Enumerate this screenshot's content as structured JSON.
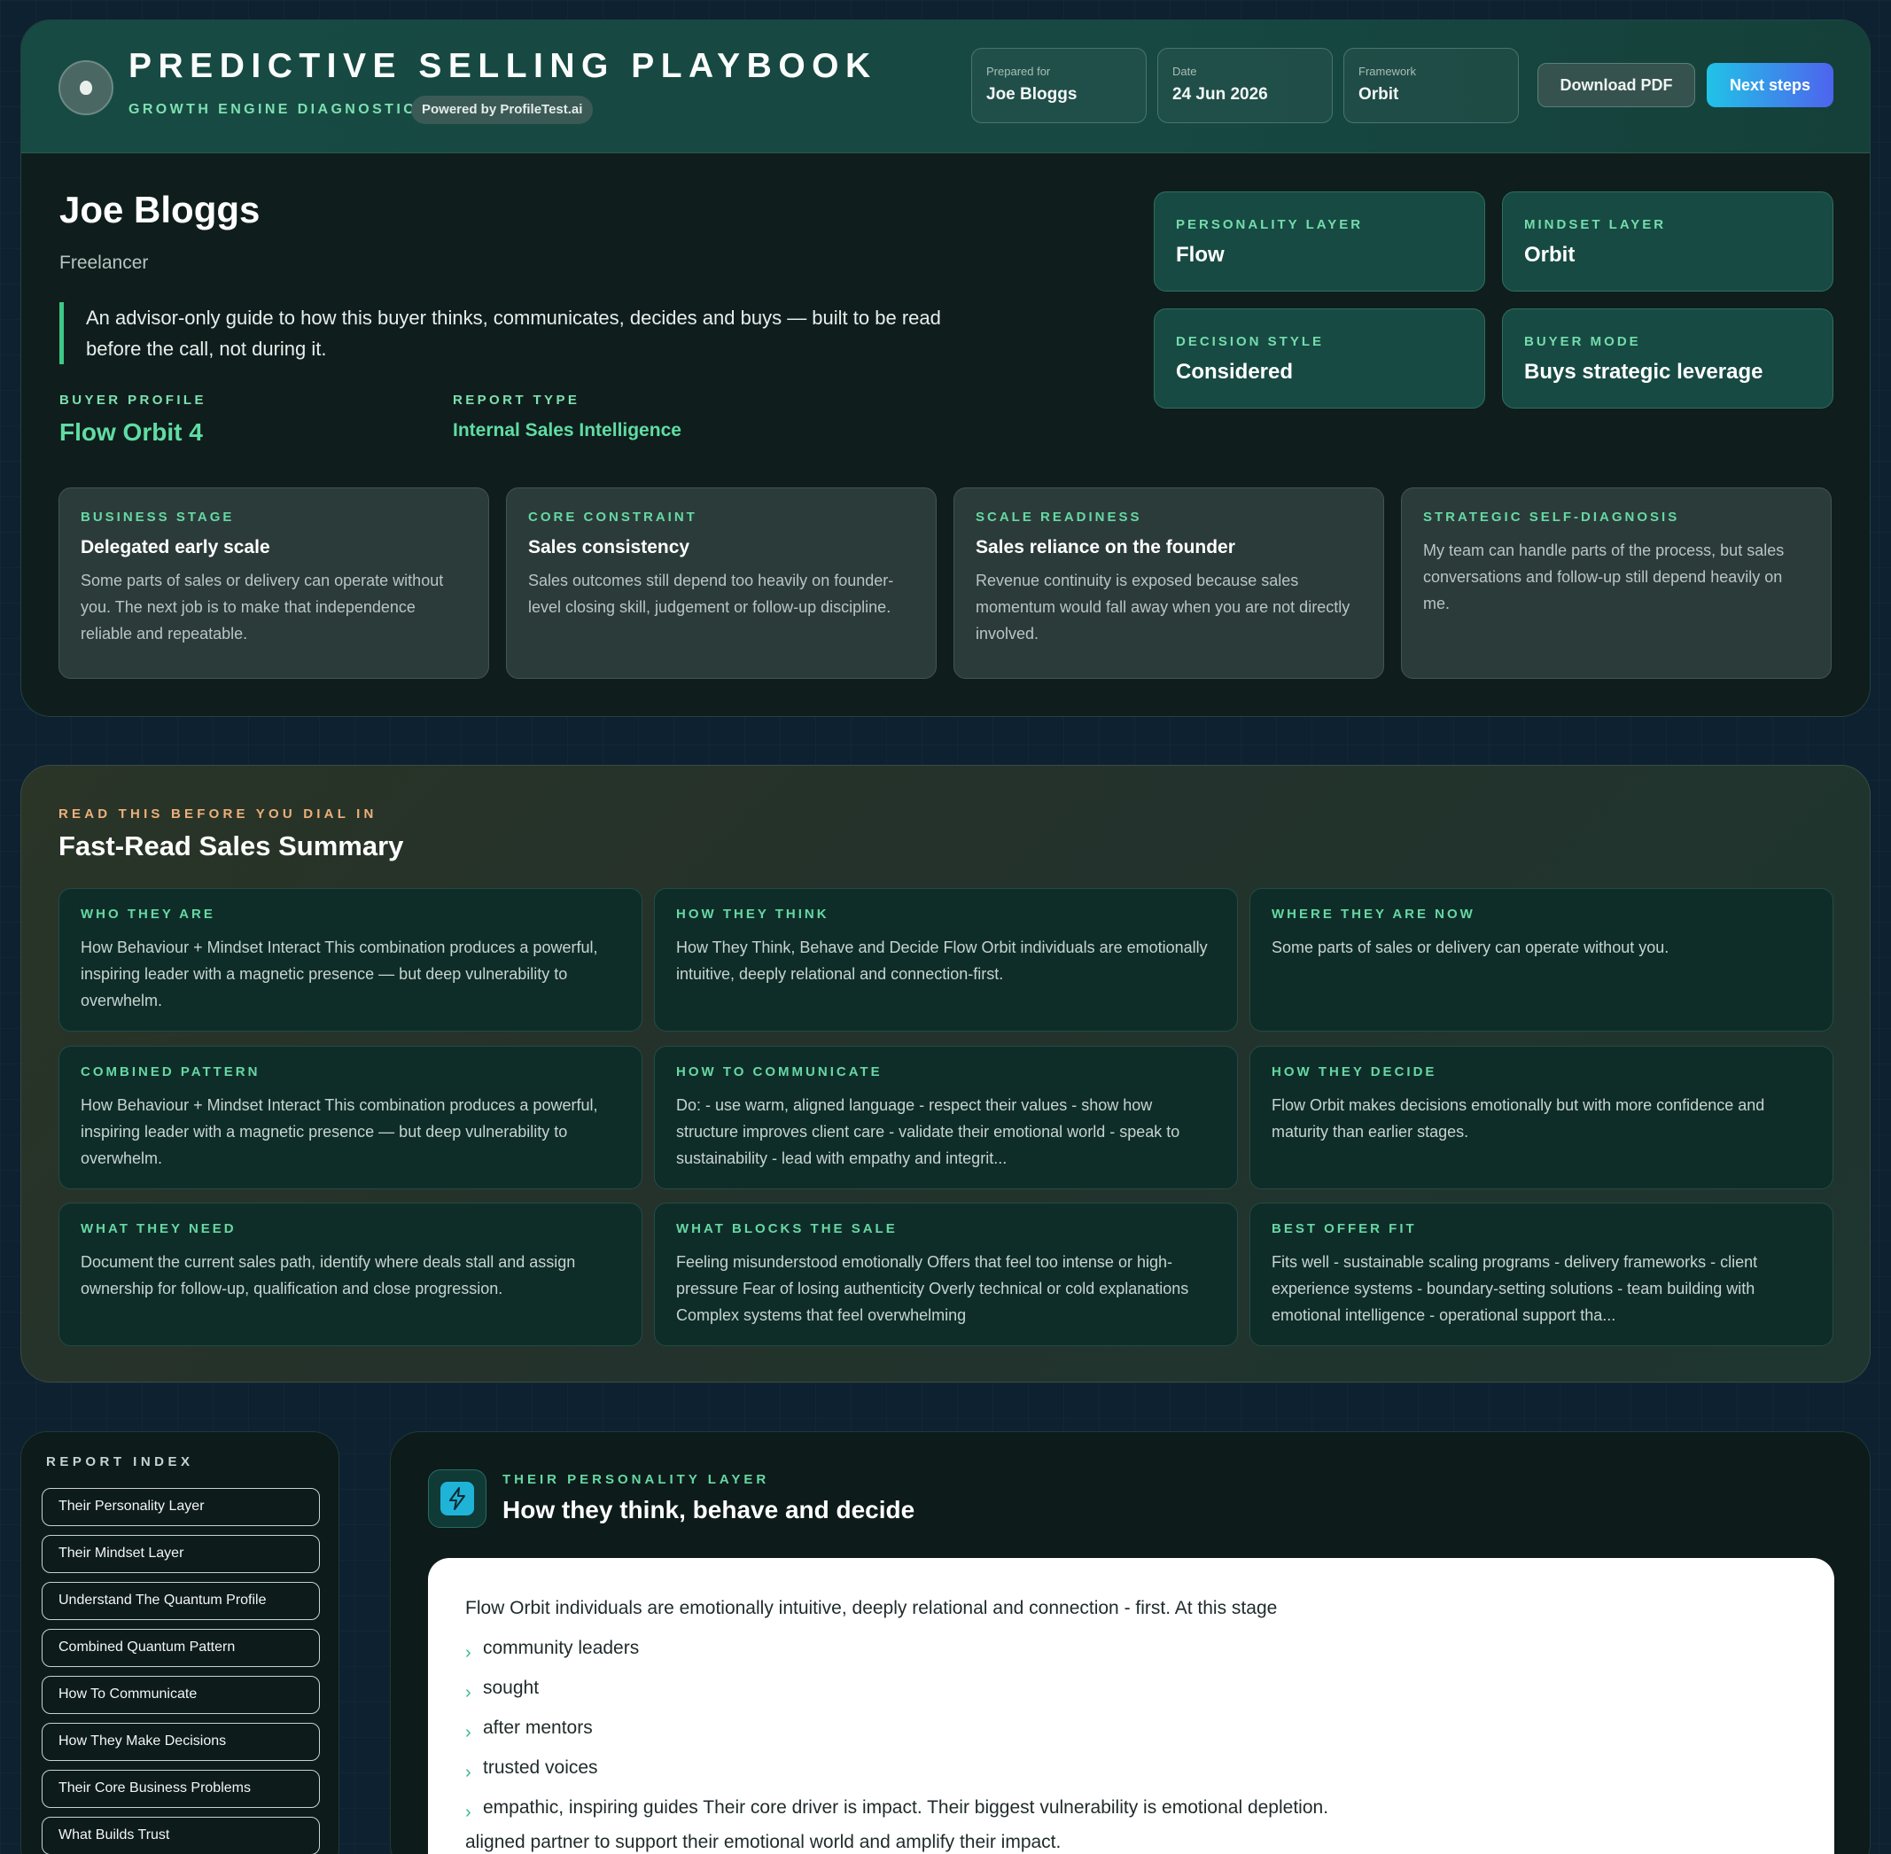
{
  "header": {
    "title": "PREDICTIVE SELLING PLAYBOOK",
    "subtitle": "GROWTH ENGINE DIAGNOSTIC",
    "powered_by": "Powered by ProfileTest.ai",
    "meta": [
      {
        "label": "Prepared for",
        "value": "Joe Bloggs"
      },
      {
        "label": "Date",
        "value": "24 Jun 2026"
      },
      {
        "label": "Framework",
        "value": "Orbit"
      }
    ],
    "download_label": "Download PDF",
    "next_label": "Next steps"
  },
  "profile": {
    "name": "Joe Bloggs",
    "role": "Freelancer",
    "intro": "An advisor-only guide to how this buyer thinks, communicates, decides and buys — built to be read before the call, not during it.",
    "buyer_profile_label": "BUYER PROFILE",
    "buyer_profile_value": "Flow Orbit 4",
    "report_type_label": "REPORT TYPE",
    "report_type_value": "Internal Sales Intelligence"
  },
  "layers": [
    {
      "label": "PERSONALITY LAYER",
      "value": "Flow"
    },
    {
      "label": "MINDSET LAYER",
      "value": "Orbit"
    },
    {
      "label": "DECISION STYLE",
      "value": "Considered"
    },
    {
      "label": "BUYER MODE",
      "value": "Buys strategic leverage"
    }
  ],
  "stages": [
    {
      "label": "BUSINESS STAGE",
      "title": "Delegated early scale",
      "text": "Some parts of sales or delivery can operate without you. The next job is to make that independence reliable and repeatable."
    },
    {
      "label": "CORE CONSTRAINT",
      "title": "Sales consistency",
      "text": "Sales outcomes still depend too heavily on founder-level closing skill, judgement or follow-up discipline."
    },
    {
      "label": "SCALE READINESS",
      "title": "Sales reliance on the founder",
      "text": "Revenue continuity is exposed because sales momentum would fall away when you are not directly involved."
    },
    {
      "label": "STRATEGIC SELF-DIAGNOSIS",
      "title": "",
      "text": "My team can handle parts of the process, but sales conversations and follow-up still depend heavily on me."
    }
  ],
  "summary": {
    "kicker": "READ THIS BEFORE YOU DIAL IN",
    "title": "Fast-Read Sales Summary",
    "tiles": [
      {
        "label": "WHO THEY ARE",
        "text": "How Behaviour + Mindset Interact This combination produces a powerful, inspiring leader with a magnetic presence — but deep vulnerability to overwhelm."
      },
      {
        "label": "HOW THEY THINK",
        "text": "How They Think, Behave and Decide Flow Orbit individuals are emotionally intuitive, deeply relational and connection-first."
      },
      {
        "label": "WHERE THEY ARE NOW",
        "text": "Some parts of sales or delivery can operate without you."
      },
      {
        "label": "COMBINED PATTERN",
        "text": "How Behaviour + Mindset Interact This combination produces a powerful, inspiring leader with a magnetic presence — but deep vulnerability to overwhelm."
      },
      {
        "label": "HOW TO COMMUNICATE",
        "text": "Do: - use warm, aligned language - respect their values - show how structure improves client care - validate their emotional world - speak to sustainability - lead with empathy and integrit..."
      },
      {
        "label": "HOW THEY DECIDE",
        "text": "Flow Orbit makes decisions emotionally but with more confidence and maturity than earlier stages."
      },
      {
        "label": "WHAT THEY NEED",
        "text": "Document the current sales path, identify where deals stall and assign ownership for follow-up, qualification and close progression."
      },
      {
        "label": "WHAT BLOCKS THE SALE",
        "text": "Feeling misunderstood emotionally Offers that feel too intense or high-pressure Fear of losing authenticity Overly technical or cold explanations Complex systems that feel overwhelming"
      },
      {
        "label": "BEST OFFER FIT",
        "text": "Fits well - sustainable scaling programs - delivery frameworks - client experience systems - boundary-setting solutions - team building with emotional intelligence - operational support tha..."
      }
    ]
  },
  "index": {
    "title": "REPORT INDEX",
    "items": [
      "Their Personality Layer",
      "Their Mindset Layer",
      "Understand The Quantum Profile",
      "Combined Quantum Pattern",
      "How To Communicate",
      "How They Make Decisions",
      "Their Core Business Problems",
      "What Builds Trust"
    ]
  },
  "section": {
    "kicker": "THEIR PERSONALITY LAYER",
    "title": "How they think, behave and decide",
    "icon": "lightning-icon",
    "lead": "Flow Orbit individuals are emotionally intuitive, deeply relational and connection - first. At this stage",
    "bullets": [
      "community leaders",
      "sought",
      "after mentors",
      "trusted voices",
      "empathic, inspiring guides Their core driver is impact. Their biggest vulnerability is emotional depletion."
    ],
    "tail": "aligned partner to support their emotional world and amplify their impact."
  },
  "colors": {
    "accent_green": "#66d8a4",
    "accent_orange": "#eeb079",
    "next_gradient_start": "#21c3e6",
    "next_gradient_end": "#4e63ee",
    "page_bg": "#0e2130"
  }
}
